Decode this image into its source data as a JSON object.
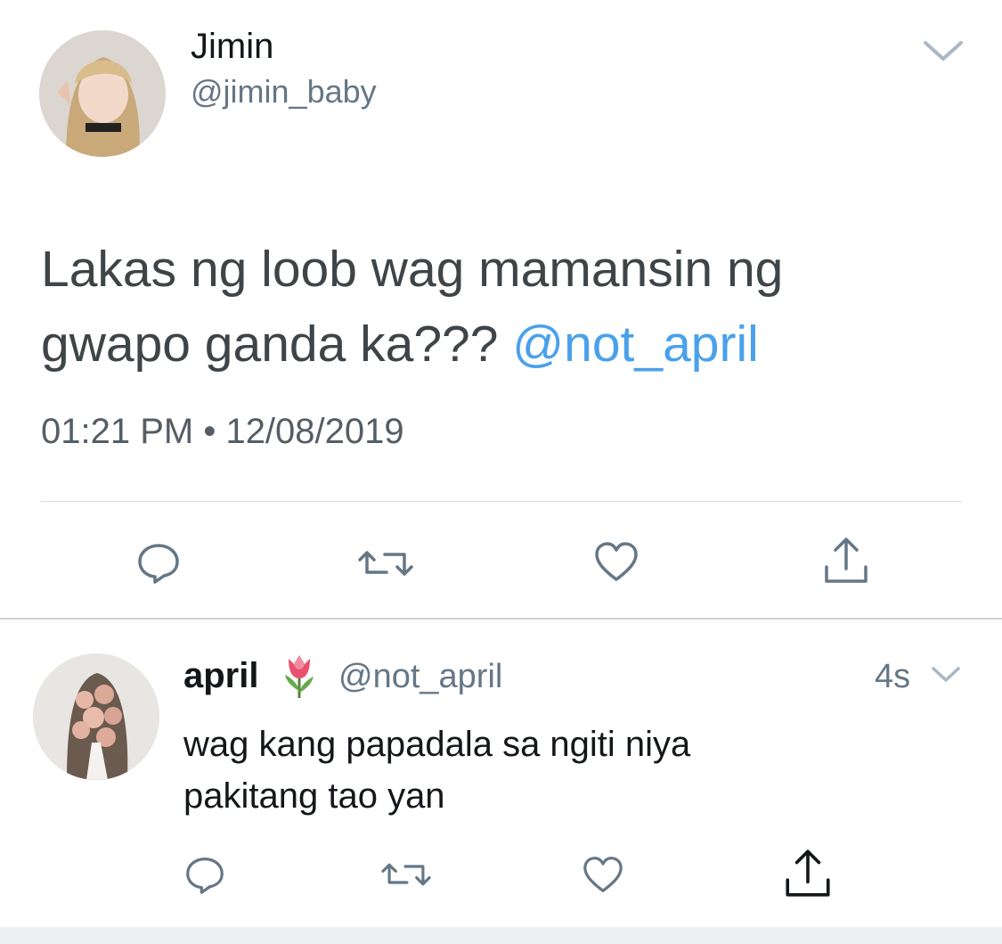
{
  "main_tweet": {
    "display_name": "Jimin",
    "handle": "@jimin_baby",
    "text_line1": "Lakas ng loob wag mamansin ng",
    "text_line2": "gwapo ganda ka???",
    "mention": "@not_april",
    "timestamp": "01:21 PM • 12/08/2019",
    "icons": {
      "menu": "chevron-down-icon",
      "reply": "reply-icon",
      "retweet": "retweet-icon",
      "like": "heart-icon",
      "share": "share-icon"
    }
  },
  "reply_tweet": {
    "display_name": "april",
    "emoji": "tulip",
    "handle": "@not_april",
    "time": "4s",
    "text_line1": "wag kang papadala sa ngiti niya",
    "text_line2": "pakitang tao yan",
    "icons": {
      "menu": "chevron-down-icon",
      "reply": "reply-icon",
      "retweet": "retweet-icon",
      "like": "heart-icon",
      "share": "share-icon"
    }
  },
  "colors": {
    "mention": "#4aa1eb",
    "secondary_text": "#657786",
    "icon": "#657786"
  }
}
